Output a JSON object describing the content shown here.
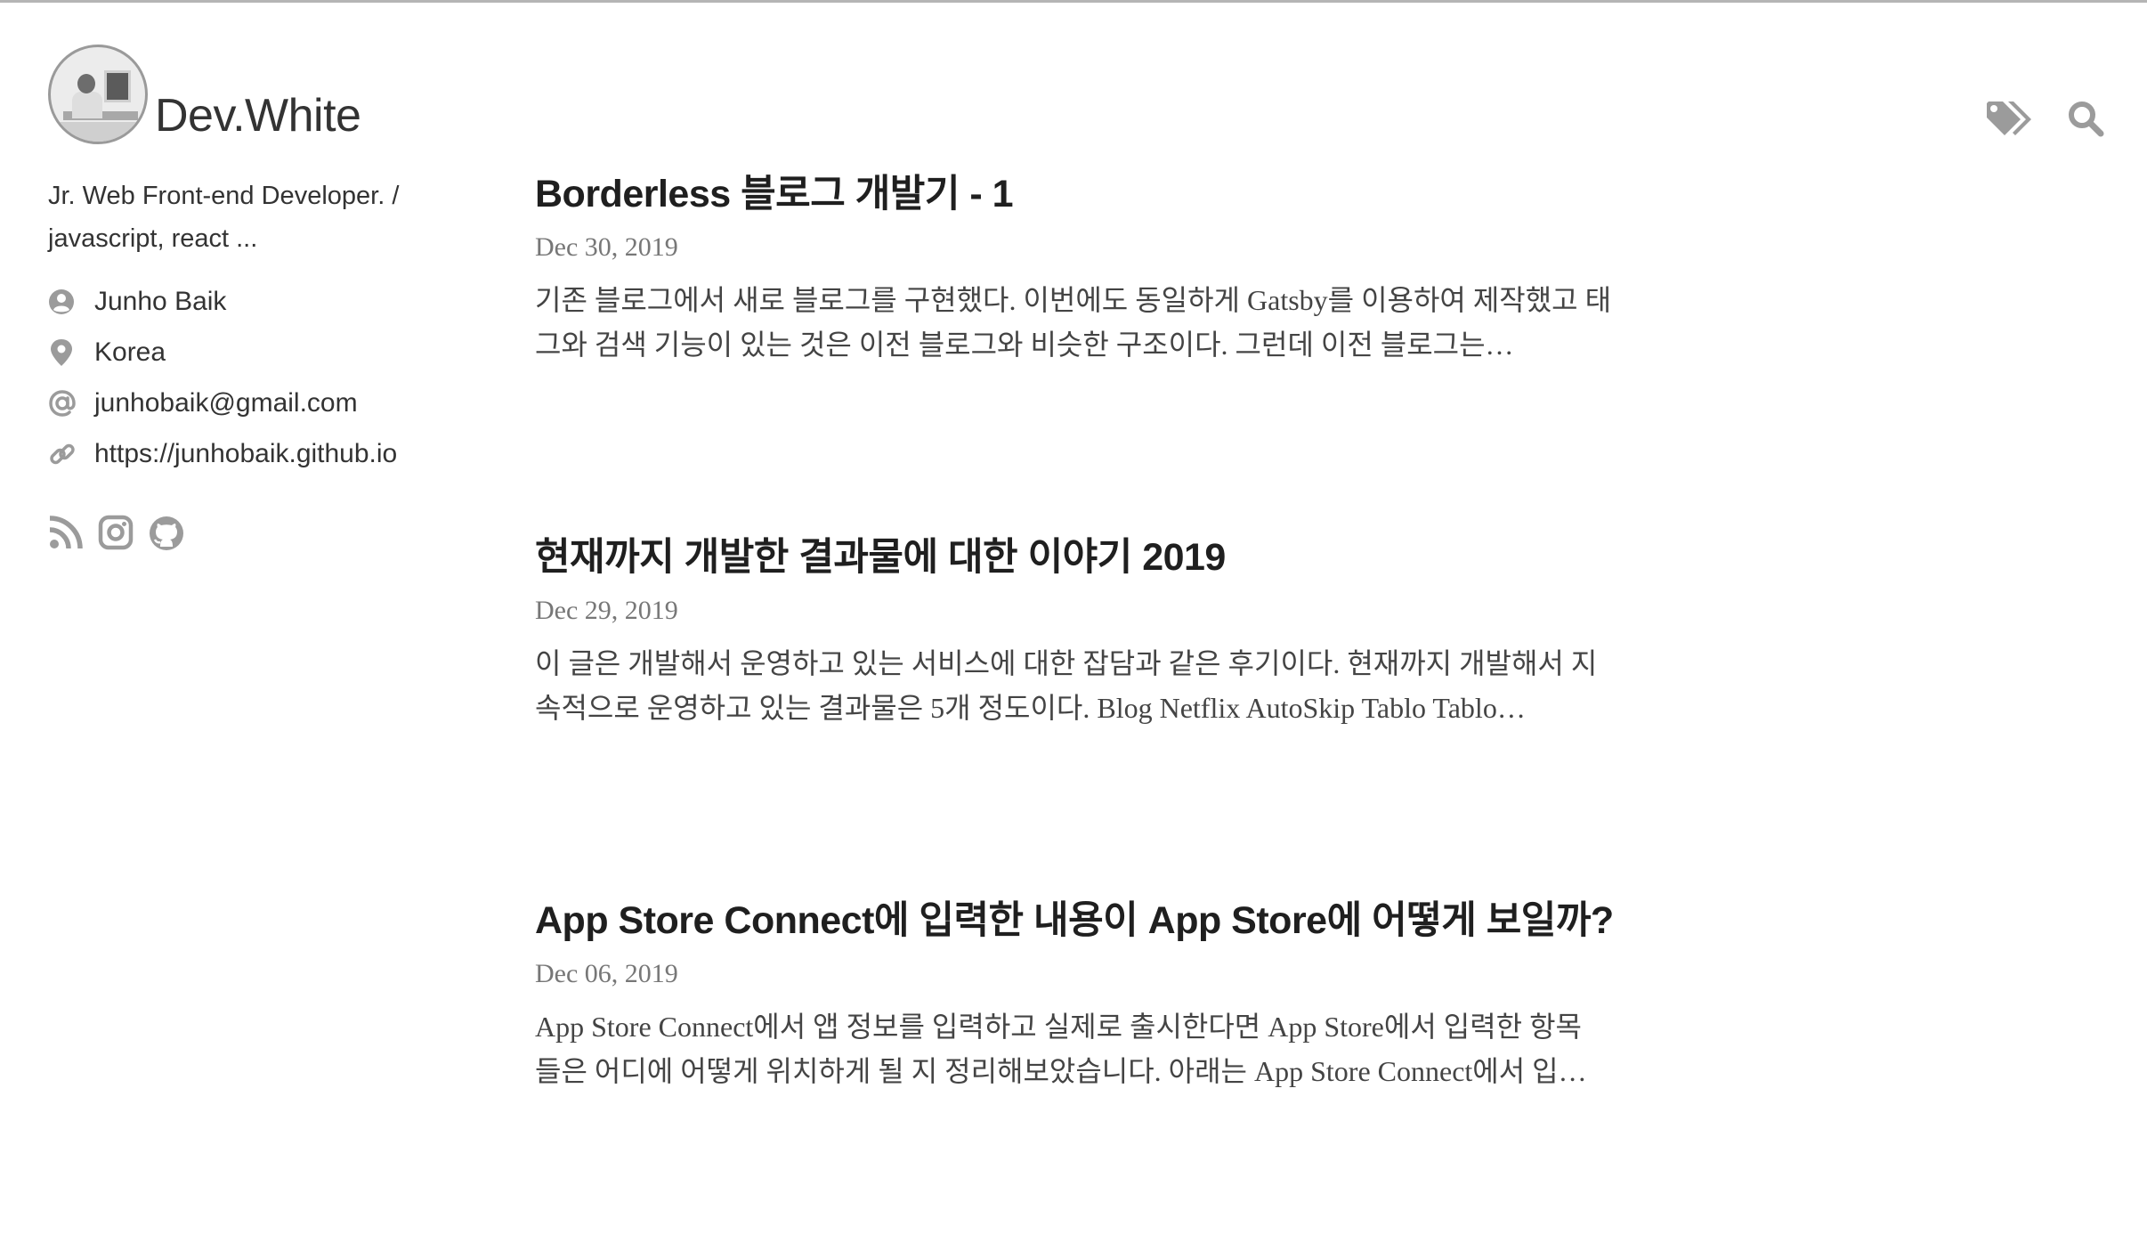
{
  "site": {
    "title": "Dev.White",
    "avatar_alt": "profile photo"
  },
  "header_icons": [
    {
      "name": "tags-icon"
    },
    {
      "name": "search-icon"
    }
  ],
  "sidebar": {
    "bio_line1": "Jr. Web Front-end Developer. /",
    "bio_line2": "javascript, react ...",
    "info": {
      "name": "Junho Baik",
      "location": "Korea",
      "email": "junhobaik@gmail.com",
      "website": "https://junhobaik.github.io"
    },
    "social": [
      "rss-icon",
      "instagram-icon",
      "github-icon"
    ]
  },
  "posts": [
    {
      "title": "Borderless 블로그 개발기 - 1",
      "date": "Dec 30, 2019",
      "excerpt_line1": "기존 블로그에서 새로 블로그를 구현했다. 이번에도 동일하게 Gatsby를 이용하여 제작했고 태",
      "excerpt_line2": "그와 검색 기능이 있는 것은 이전 블로그와 비슷한 구조이다. 그런데 이전 블로그는…"
    },
    {
      "title": "현재까지 개발한 결과물에 대한 이야기 2019",
      "date": "Dec 29, 2019",
      "excerpt_line1": "이 글은 개발해서 운영하고 있는 서비스에 대한 잡담과 같은 후기이다. 현재까지 개발해서 지",
      "excerpt_line2": "속적으로 운영하고 있는 결과물은 5개 정도이다. Blog Netflix AutoSkip Tablo Tablo…"
    },
    {
      "title": "App Store Connect에 입력한 내용이 App Store에 어떻게 보일까?",
      "date": "Dec 06, 2019",
      "excerpt_line1": "App Store Connect에서 앱 정보를 입력하고 실제로 출시한다면 App Store에서 입력한 항목",
      "excerpt_line2": "들은 어디에 어떻게 위치하게 될 지 정리해보았습니다. 아래는 App Store Connect에서 입…"
    }
  ],
  "colors": {
    "icon_gray": "#9b9b9b",
    "title_text": "#1f1f1f",
    "date_text": "#777777",
    "body_text": "#444444"
  }
}
